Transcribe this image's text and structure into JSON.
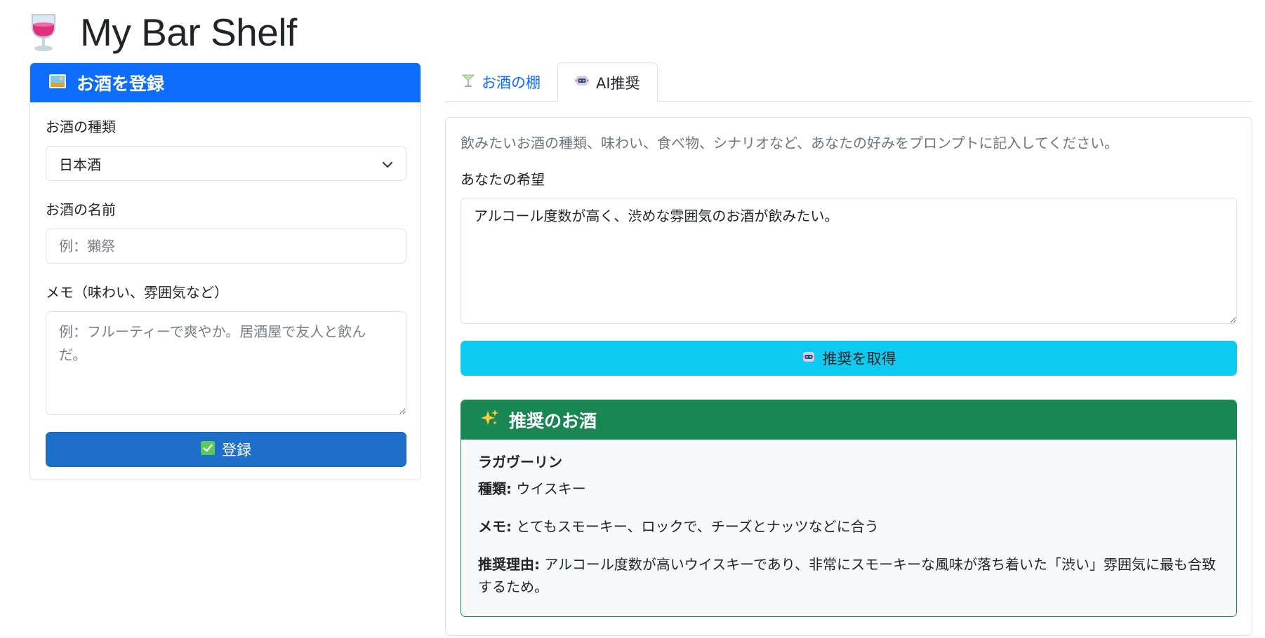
{
  "app": {
    "title": "My Bar Shelf"
  },
  "register": {
    "header": "お酒を登録",
    "type_label": "お酒の種類",
    "type_selected": "日本酒",
    "name_label": "お酒の名前",
    "name_placeholder": "例：獺祭",
    "memo_label": "メモ（味わい、雰囲気など）",
    "memo_placeholder": "例：フルーティーで爽やか。居酒屋で友人と飲んだ。",
    "submit_label": "登録"
  },
  "tabs": [
    {
      "label": "お酒の棚",
      "icon": "cocktail-icon",
      "active": false
    },
    {
      "label": "AI推奨",
      "icon": "robot-icon",
      "active": true
    }
  ],
  "ai": {
    "description": "飲みたいお酒の種類、味わい、食べ物、シナリオなど、あなたの好みをプロンプトに記入してください。",
    "wish_label": "あなたの希望",
    "wish_value": "アルコール度数が高く、渋めな雰囲気のお酒が飲みたい。",
    "button_label": "推奨を取得"
  },
  "recommendation": {
    "header": "推奨のお酒",
    "name": "ラガヴーリン",
    "type_key": "種類:",
    "type_value": " ウイスキー",
    "memo_key": "メモ:",
    "memo_value": " とてもスモーキー、ロックで、チーズとナッツなどに合う",
    "reason_key": "推奨理由:",
    "reason_value": " アルコール度数が高いウイスキーであり、非常にスモーキーな風味が落ち着いた「渋い」雰囲気に最も合致するため。"
  },
  "colors": {
    "primary": "#0d6efd",
    "register_button": "#1e6fc9",
    "info": "#0dcaf0",
    "success": "#198754",
    "border": "#dee2e6",
    "muted": "#6c757d"
  }
}
